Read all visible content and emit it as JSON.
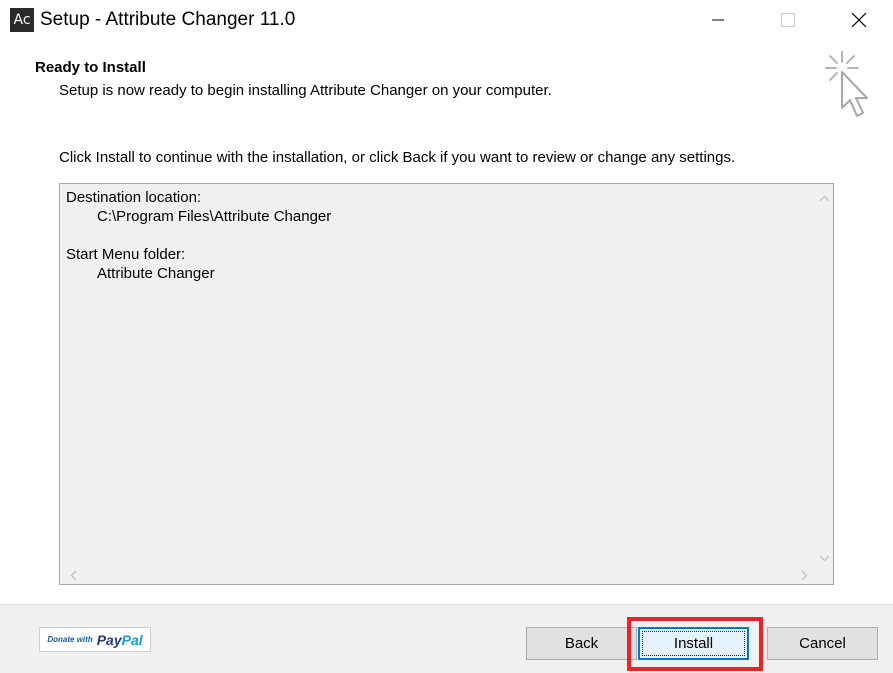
{
  "window": {
    "icon_text": "Ac",
    "title": "Setup - Attribute Changer 11.0",
    "controls": [
      "minimize",
      "maximize",
      "close"
    ]
  },
  "header": {
    "title": "Ready to Install",
    "subtitle": "Setup is now ready to begin installing Attribute Changer on your computer."
  },
  "body": {
    "instruction": "Click Install to continue with the installation, or click Back if you want to review or change any settings.",
    "memo": {
      "destination_label": "Destination location:",
      "destination_value": "C:\\Program Files\\Attribute Changer",
      "start_menu_label": "Start Menu folder:",
      "start_menu_value": "Attribute Changer"
    }
  },
  "footer": {
    "paypal": {
      "small": "Donate with",
      "pay": "Pay",
      "pal": "Pal"
    },
    "back_label": "Back",
    "install_label": "Install",
    "cancel_label": "Cancel"
  },
  "colors": {
    "highlight": "#e8232a",
    "default_button_border": "#0078d7",
    "paypal_dark": "#253b80",
    "paypal_light": "#179bd7"
  }
}
